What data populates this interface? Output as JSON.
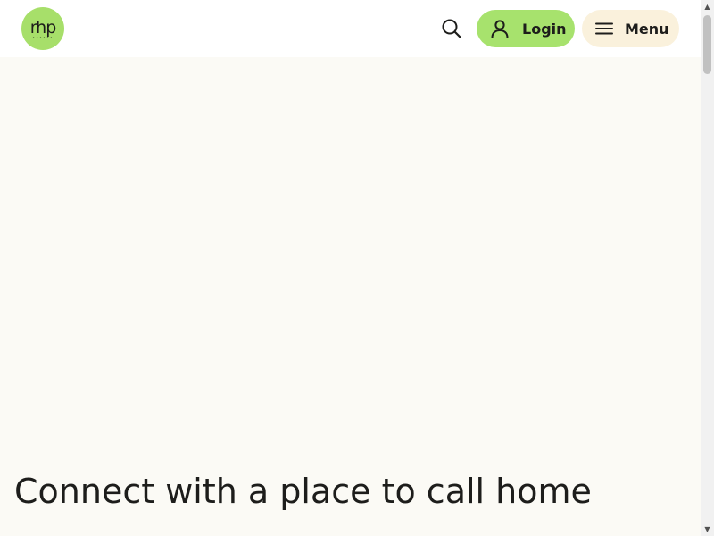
{
  "header": {
    "logo_text": "rhp",
    "search_icon": "search-icon",
    "login_label": "Login",
    "login_icon": "user-icon",
    "menu_label": "Menu",
    "menu_icon": "hamburger-icon"
  },
  "hero": {
    "title": "Connect with a place to call home"
  },
  "colors": {
    "brand_green": "#a7e26d",
    "menu_bg": "#faf1dc",
    "page_bg": "#fbfaf5",
    "text": "#1d1d1b"
  }
}
